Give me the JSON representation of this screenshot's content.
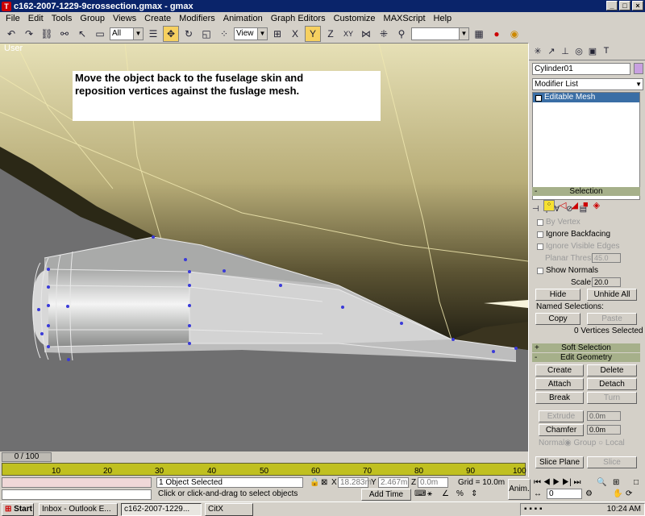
{
  "window": {
    "title": "c162-2007-1229-9crossection.gmax - gmax"
  },
  "menu": [
    "File",
    "Edit",
    "Tools",
    "Group",
    "Views",
    "Create",
    "Modifiers",
    "Animation",
    "Graph Editors",
    "Customize",
    "MAXScript",
    "Help"
  ],
  "toolbar": {
    "filter_value": "All",
    "ref_coord_value": "View",
    "named_sel_value": ""
  },
  "viewport": {
    "label": "User",
    "note_line1": "Move the object back to the fuselage skin and",
    "note_line2": "reposition vertices against the fuslage mesh."
  },
  "timeline": {
    "frame_indicator": "0 / 100",
    "ticks": [
      "10",
      "20",
      "30",
      "40",
      "50",
      "60",
      "70",
      "80",
      "90",
      "100"
    ]
  },
  "status": {
    "selected": "1 Object Selected",
    "prompt": "Click or click-and-drag to select objects",
    "x_label": "X",
    "x_value": "18.283m",
    "y_label": "Y",
    "y_value": "2.467m",
    "z_label": "Z",
    "z_value": "0.0m",
    "grid": "Grid = 10.0m",
    "add_time_tag": "Add Time Tag",
    "anim": "Anim.",
    "frame_value": "0"
  },
  "command_panel": {
    "object_name": "Cylinder01",
    "modifier_list": "Modifier List",
    "stack_item": "Editable Mesh",
    "selection_title": "Selection",
    "by_vertex": "By Vertex",
    "ignore_backfacing": "Ignore Backfacing",
    "ignore_visible_edges": "Ignore Visible Edges",
    "planar_thresh": "Planar Thresh:",
    "planar_value": "45.0",
    "show_normals": "Show Normals",
    "scale_label": "Scale:",
    "scale_value": "20.0",
    "hide": "Hide",
    "unhide_all": "Unhide All",
    "named_selections": "Named Selections:",
    "copy": "Copy",
    "paste": "Paste",
    "vertices_selected": "0 Vertices Selected",
    "soft_selection": "Soft Selection",
    "edit_geometry": "Edit Geometry",
    "create": "Create",
    "delete": "Delete",
    "attach": "Attach",
    "detach": "Detach",
    "break": "Break",
    "turn": "Turn",
    "extrude": "Extrude",
    "extrude_value": "0.0m",
    "chamfer": "Chamfer",
    "chamfer_value": "0.0m",
    "normal_label": "Normal:",
    "group": "Group",
    "local": "Local",
    "slice_plane": "Slice Plane",
    "slice": "Slice",
    "plus": "+",
    "minus": "-"
  },
  "taskbar": {
    "start": "Start",
    "tasks": [
      "Inbox - Outlook E...",
      "c162-2007-1229...",
      "CitX"
    ],
    "clock": "10:24 AM"
  }
}
